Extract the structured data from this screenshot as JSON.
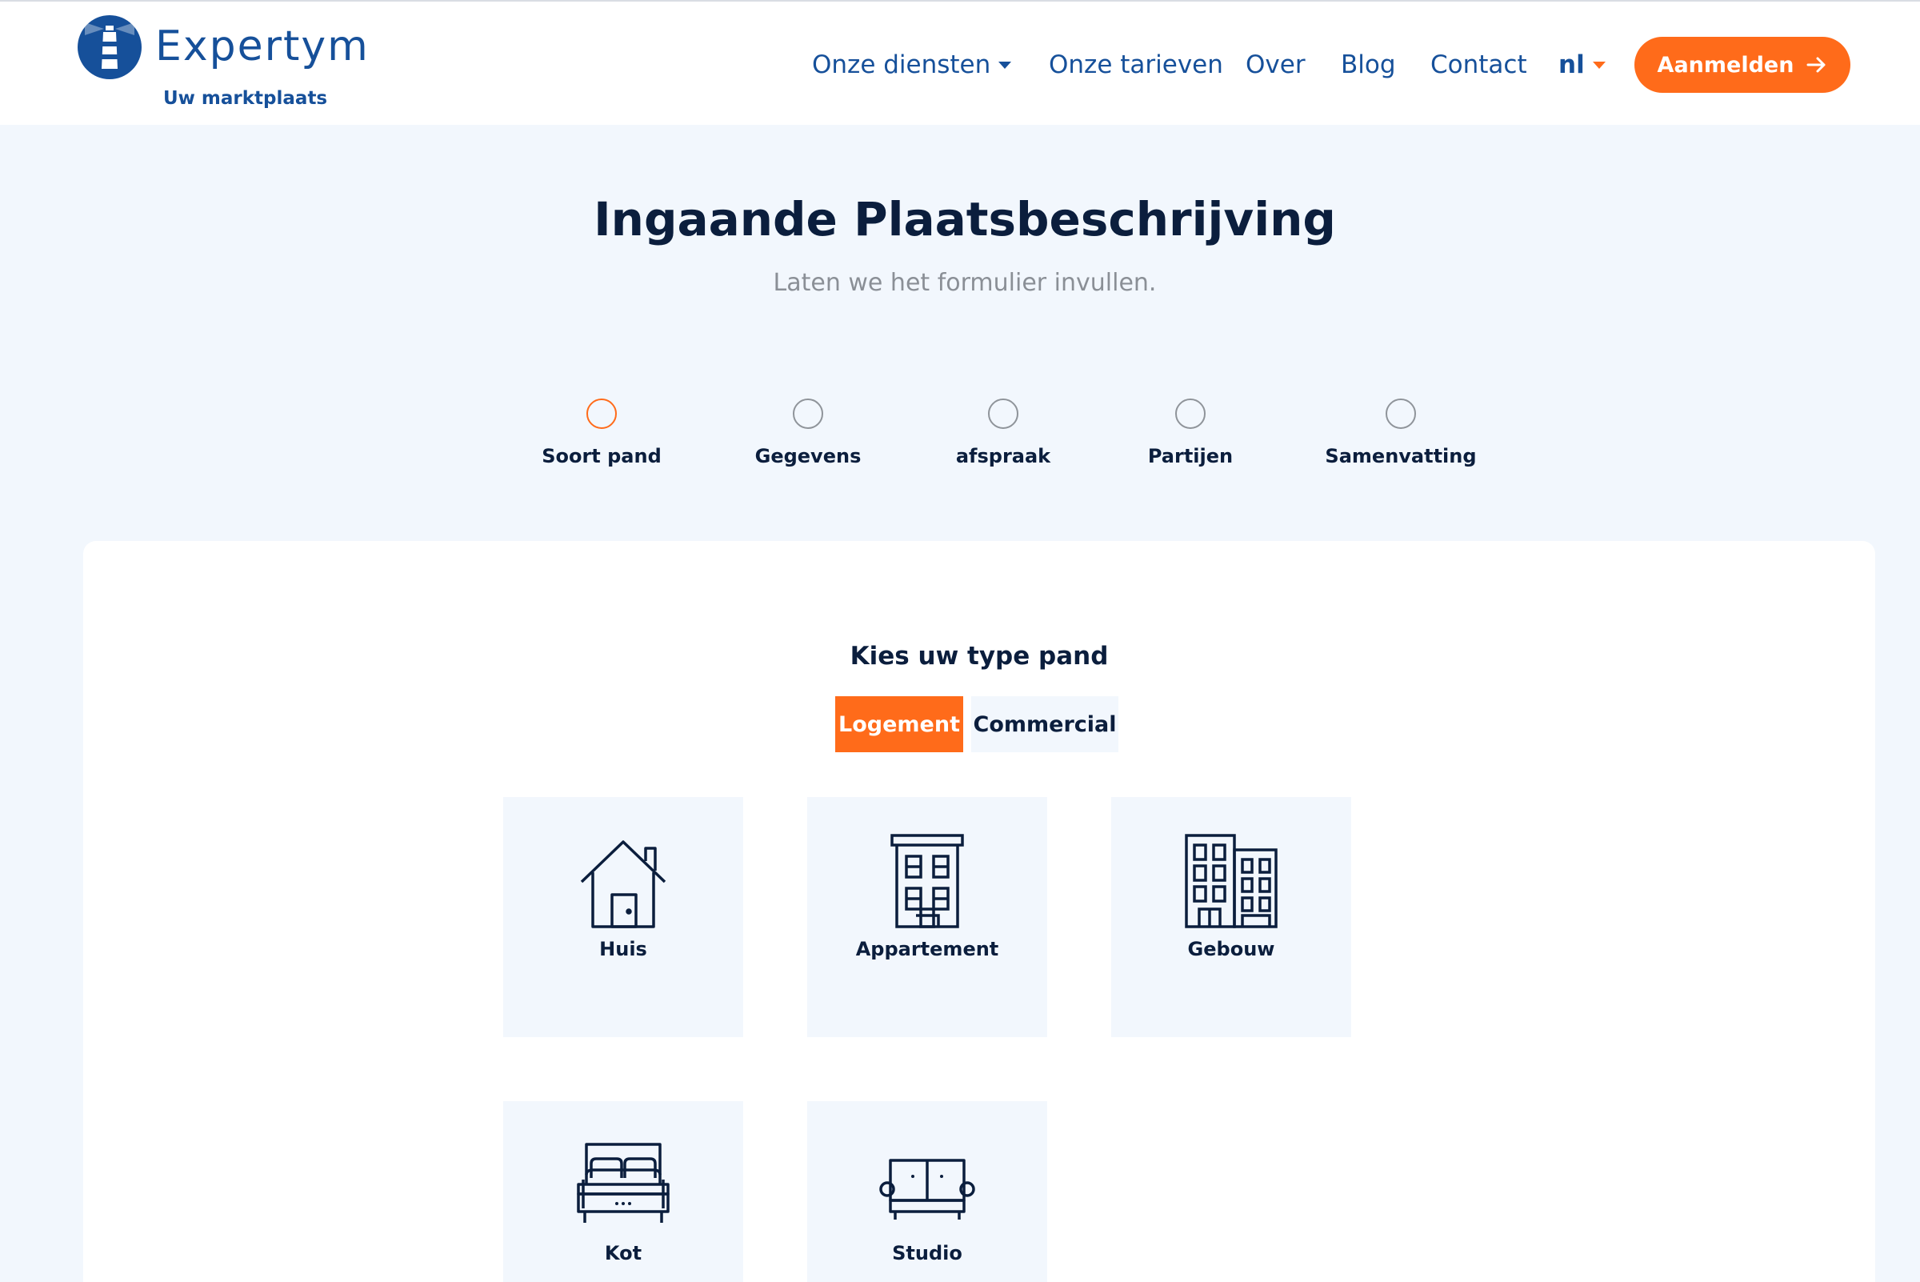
{
  "brand": {
    "name": "Expertym",
    "tagline": "Uw marktplaats",
    "primary_color": "#16509a",
    "accent_color": "#ff6b1a"
  },
  "nav": {
    "items": [
      {
        "label": "Onze diensten",
        "has_dropdown": true
      },
      {
        "label": "Onze tarieven"
      },
      {
        "label": "Over"
      },
      {
        "label": "Blog"
      },
      {
        "label": "Contact"
      }
    ],
    "language": "nl",
    "cta_label": "Aanmelden"
  },
  "page": {
    "title": "Ingaande Plaatsbeschrijving",
    "subtitle": "Laten we het formulier invullen."
  },
  "steps": [
    {
      "label": "Soort pand",
      "active": true
    },
    {
      "label": "Gegevens",
      "active": false
    },
    {
      "label": "afspraak",
      "active": false
    },
    {
      "label": "Partijen",
      "active": false
    },
    {
      "label": "Samenvatting",
      "active": false
    }
  ],
  "form": {
    "heading": "Kies uw type pand",
    "types": [
      {
        "label": "Logement",
        "selected": true
      },
      {
        "label": "Commercial",
        "selected": false
      }
    ],
    "properties": [
      {
        "label": "Huis",
        "icon": "house-icon"
      },
      {
        "label": "Appartement",
        "icon": "apartment-icon"
      },
      {
        "label": "Gebouw",
        "icon": "building-icon"
      },
      {
        "label": "Kot",
        "icon": "bed-icon"
      },
      {
        "label": "Studio",
        "icon": "sofa-icon"
      }
    ]
  }
}
